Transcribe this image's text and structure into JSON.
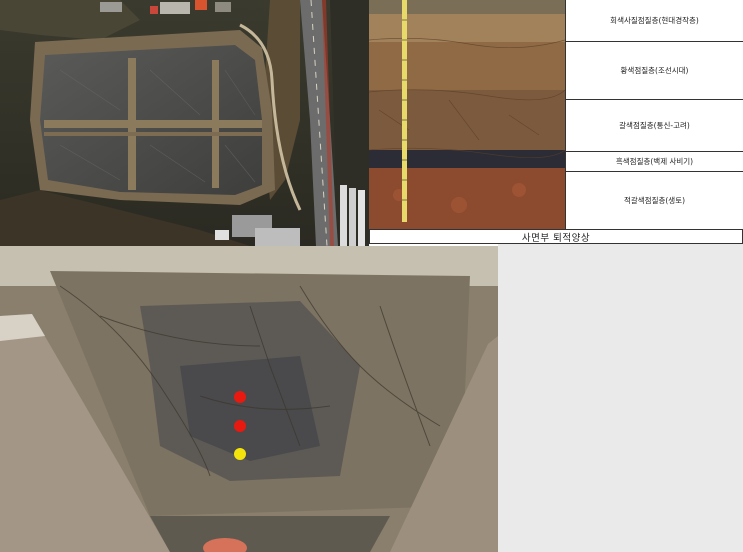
{
  "sediment_profile": {
    "caption": "사면부 퇴적양상",
    "layers": [
      {
        "label": "회색사질점질층(현대경작층)"
      },
      {
        "label": "황색점질층(조선시대)"
      },
      {
        "label": "갈색점질층(통신-고려)"
      },
      {
        "label": "흑색점질층(백제 사비기)"
      },
      {
        "label": "적갈색점질층(생토)"
      }
    ]
  },
  "sample_points": [
    {
      "color": "#e8190f"
    },
    {
      "color": "#e8190f"
    },
    {
      "color": "#f5e30c"
    }
  ],
  "colors": {
    "sample_red": "#e8190f",
    "sample_yellow": "#f5e30c",
    "table_border": "#333333"
  }
}
